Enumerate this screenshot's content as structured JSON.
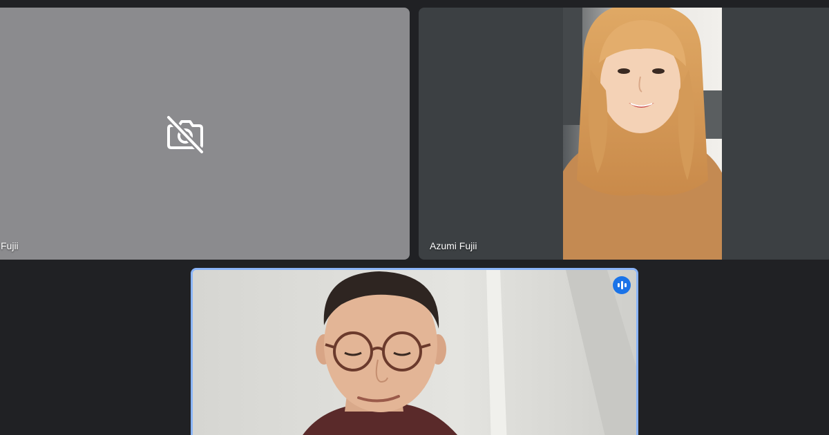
{
  "meeting": {
    "tiles": [
      {
        "id": "participant-camera-off",
        "name": "i Fujii",
        "camera": "off",
        "icon": "camera-off-icon",
        "background": "#8b8b8e"
      },
      {
        "id": "participant-azumi",
        "name": "Azumi Fujii",
        "camera": "on",
        "background": "#3c4043"
      },
      {
        "id": "participant-active-speaker",
        "name": "",
        "camera": "on",
        "speaking": true,
        "indicator_icon": "audio-level-icon",
        "highlight_color": "#8ab4f8",
        "indicator_color": "#1a73e8"
      }
    ]
  }
}
